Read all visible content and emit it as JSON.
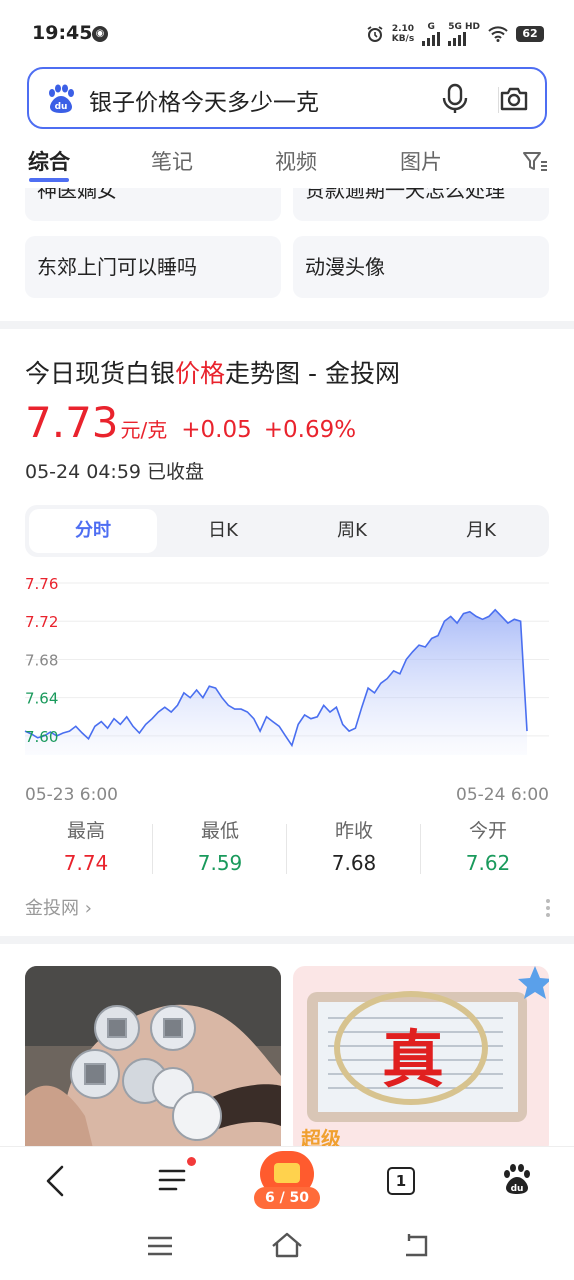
{
  "status_bar": {
    "time": "19:45",
    "speed_top": "2.10",
    "speed_bottom": "KB/s",
    "net1": "G",
    "net2": "5G HD",
    "battery": "62"
  },
  "search": {
    "query": "银子价格今天多少一克"
  },
  "tabs": [
    {
      "label": "综合"
    },
    {
      "label": "笔记"
    },
    {
      "label": "视频"
    },
    {
      "label": "图片"
    }
  ],
  "related": [
    {
      "label": "神医嫡女"
    },
    {
      "label": "贷款逾期一天怎么处理"
    },
    {
      "label": "东郊上门可以睡吗"
    },
    {
      "label": "动漫头像"
    }
  ],
  "card": {
    "title_part1": "今日现货白银",
    "title_highlight": "价格",
    "title_part2": "走势图 - 金投网",
    "price": "7.73",
    "unit": "元/克",
    "change": "+0.05",
    "change_pct": "+0.69%",
    "date": "05-24 04:59 已收盘",
    "periods": [
      {
        "label": "分时"
      },
      {
        "label": "日K"
      },
      {
        "label": "周K"
      },
      {
        "label": "月K"
      }
    ],
    "stats": [
      {
        "label": "最高",
        "value": "7.74",
        "color": "#e9232d"
      },
      {
        "label": "最低",
        "value": "7.59",
        "color": "#1a9a5c"
      },
      {
        "label": "昨收",
        "value": "7.68",
        "color": "#222222"
      },
      {
        "label": "今开",
        "value": "7.62",
        "color": "#1a9a5c"
      }
    ],
    "source": "金投网 ›"
  },
  "chart_data": {
    "type": "area",
    "yticks": [
      "7.76",
      "7.72",
      "7.68",
      "7.64",
      "7.60"
    ],
    "ylim": [
      7.58,
      7.76
    ],
    "x_start_label": "05-23 6:00",
    "x_end_label": "05-24 6:00",
    "series": [
      {
        "values": [
          7.605,
          7.602,
          7.598,
          7.6,
          7.604,
          7.6,
          7.603,
          7.605,
          7.61,
          7.603,
          7.597,
          7.61,
          7.615,
          7.608,
          7.618,
          7.612,
          7.62,
          7.61,
          7.603,
          7.612,
          7.618,
          7.625,
          7.63,
          7.625,
          7.632,
          7.645,
          7.64,
          7.648,
          7.64,
          7.652,
          7.65,
          7.64,
          7.632,
          7.628,
          7.628,
          7.625,
          7.618,
          7.605,
          7.62,
          7.615,
          7.61,
          7.6,
          7.59,
          7.612,
          7.622,
          7.618,
          7.62,
          7.632,
          7.625,
          7.63,
          7.612,
          7.605,
          7.608,
          7.63,
          7.65,
          7.645,
          7.655,
          7.66,
          7.668,
          7.665,
          7.68,
          7.688,
          7.695,
          7.693,
          7.702,
          7.705,
          7.72,
          7.725,
          7.718,
          7.728,
          7.73,
          7.725,
          7.722,
          7.725,
          7.732,
          7.725,
          7.718,
          7.722,
          7.72,
          7.605
        ]
      }
    ],
    "colors": {
      "line": "#4a6ff0",
      "tick_red": "#e9232d",
      "tick_green": "#1a9a5c"
    }
  },
  "grid_images": [
    {
      "overlay_text": "真"
    },
    {
      "overlay_text": "超级"
    }
  ],
  "bottom_nav": {
    "counter": "6 / 50",
    "tabs_count": "1"
  }
}
